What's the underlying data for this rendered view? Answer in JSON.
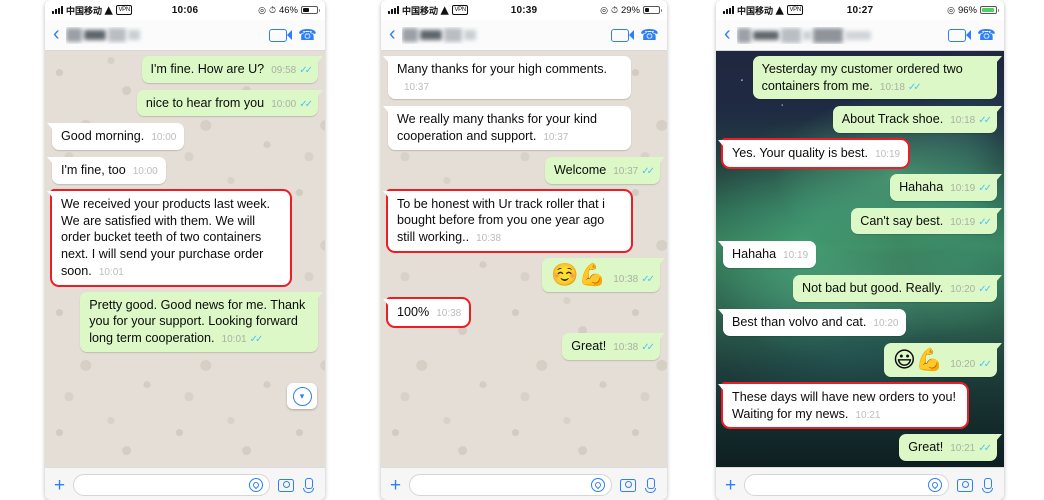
{
  "panels": [
    {
      "id": "panel-1",
      "status": {
        "carrier": "中国移动",
        "vpn": "VPN",
        "time": "10:06",
        "battery": "46%",
        "charging": false
      },
      "nav": {
        "back": "‹",
        "video_call": "video-call",
        "voice_call": "voice-call"
      },
      "wallpaper": "light-doodle",
      "messages": [
        {
          "side": "out",
          "text": "I'm fine. How are U?",
          "time": "09:58",
          "ticks": true,
          "highlight": false
        },
        {
          "side": "out",
          "text": "nice to hear from you",
          "time": "10:00",
          "ticks": true,
          "highlight": false
        },
        {
          "side": "in",
          "text": "Good morning.",
          "time": "10:00",
          "ticks": false,
          "highlight": false
        },
        {
          "side": "in",
          "text": "I'm fine, too",
          "time": "10:00",
          "ticks": false,
          "highlight": false
        },
        {
          "side": "in",
          "text": "We received your products last week. We are satisfied with them. We will order bucket teeth of two containers next. I will send your purchase order soon.",
          "time": "10:01",
          "ticks": false,
          "highlight": true
        },
        {
          "side": "out",
          "text": "Pretty good. Good news for me. Thank you for your support. Looking forward long term cooperation.",
          "time": "10:01",
          "ticks": true,
          "highlight": false
        }
      ],
      "scroll_button": "scroll-to-bottom",
      "input": {
        "plus": "+",
        "placeholder": "",
        "value": "",
        "sticker": "sticker-icon",
        "camera": "camera-icon",
        "mic": "mic-icon"
      }
    },
    {
      "id": "panel-2",
      "status": {
        "carrier": "中国移动",
        "vpn": "VPN",
        "time": "10:39",
        "battery": "29%",
        "charging": false
      },
      "nav": {
        "back": "‹",
        "video_call": "video-call",
        "voice_call": "voice-call"
      },
      "wallpaper": "light-doodle",
      "messages": [
        {
          "side": "in",
          "text": "Many thanks for your high comments.",
          "time": "10:37",
          "ticks": false,
          "highlight": false
        },
        {
          "side": "in",
          "text": "We really many thanks for your kind cooperation and support.",
          "time": "10:37",
          "ticks": false,
          "highlight": false
        },
        {
          "side": "out",
          "text": "Welcome",
          "time": "10:37",
          "ticks": true,
          "highlight": false
        },
        {
          "side": "in",
          "text": "To be honest with Ur track roller that i bought before from you one year ago still working..",
          "time": "10:38",
          "ticks": false,
          "highlight": true
        },
        {
          "side": "out",
          "text": "☺️💪",
          "time": "10:38",
          "ticks": true,
          "highlight": false,
          "emoji": true
        },
        {
          "side": "in",
          "text": "100%",
          "time": "10:38",
          "ticks": false,
          "highlight": true
        },
        {
          "side": "out",
          "text": "Great!",
          "time": "10:38",
          "ticks": true,
          "highlight": false
        }
      ],
      "input": {
        "plus": "+",
        "placeholder": "",
        "value": "",
        "sticker": "sticker-icon",
        "camera": "camera-icon",
        "mic": "mic-icon"
      }
    },
    {
      "id": "panel-3",
      "status": {
        "carrier": "中国移动",
        "vpn": "VPN",
        "time": "10:27",
        "battery": "96%",
        "charging": true
      },
      "nav": {
        "back": "‹",
        "video_call": "video-call",
        "voice_call": "voice-call"
      },
      "wallpaper": "aurora",
      "messages": [
        {
          "side": "out",
          "text": "Yesterday my customer ordered two containers from me.",
          "time": "10:18",
          "ticks": true,
          "highlight": false
        },
        {
          "side": "out",
          "text": "About Track shoe.",
          "time": "10:18",
          "ticks": true,
          "highlight": false
        },
        {
          "side": "in",
          "text": "Yes. Your quality is best.",
          "time": "10:19",
          "ticks": false,
          "highlight": true
        },
        {
          "side": "out",
          "text": "Hahaha",
          "time": "10:19",
          "ticks": true,
          "highlight": false
        },
        {
          "side": "out",
          "text": "Can't say best.",
          "time": "10:19",
          "ticks": true,
          "highlight": false
        },
        {
          "side": "in",
          "text": "Hahaha",
          "time": "10:19",
          "ticks": false,
          "highlight": false
        },
        {
          "side": "out",
          "text": "Not bad but good. Really.",
          "time": "10:20",
          "ticks": true,
          "highlight": false
        },
        {
          "side": "in",
          "text": "Best than volvo and cat.",
          "time": "10:20",
          "ticks": false,
          "highlight": false
        },
        {
          "side": "out",
          "text": "😃💪",
          "time": "10:20",
          "ticks": true,
          "highlight": false,
          "emoji": true
        },
        {
          "side": "in",
          "text": "These days will have new orders to you! Waiting for my news.",
          "time": "10:21",
          "ticks": false,
          "highlight": true
        },
        {
          "side": "out",
          "text": "Great!",
          "time": "10:21",
          "ticks": true,
          "highlight": false
        }
      ],
      "input": {
        "plus": "+",
        "placeholder": "",
        "value": "",
        "sticker": "sticker-icon",
        "camera": "camera-icon",
        "mic": "mic-icon"
      }
    }
  ],
  "colors": {
    "outgoing_bubble": "#dcf8c6",
    "incoming_bubble": "#ffffff",
    "highlight": "#ee1c24",
    "accent_blue": "#2d7ff9",
    "tick_blue": "#4fc3f7",
    "wallpaper_light": "#e4ded6"
  },
  "ticks_glyph": "✓✓"
}
